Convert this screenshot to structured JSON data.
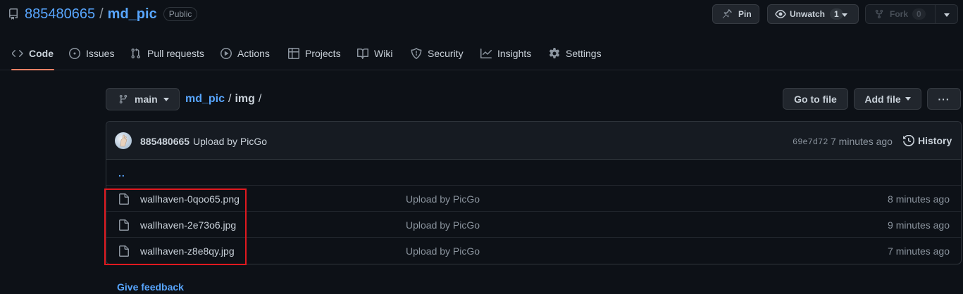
{
  "repo": {
    "owner": "885480665",
    "separator": "/",
    "name": "md_pic",
    "visibility": "Public"
  },
  "header_actions": {
    "pin_label": "Pin",
    "unwatch_label": "Unwatch",
    "watch_count": "1",
    "fork_label": "Fork",
    "fork_count": "0"
  },
  "tabs": [
    {
      "label": "Code",
      "icon": "code-icon",
      "active": true
    },
    {
      "label": "Issues",
      "icon": "issue-icon"
    },
    {
      "label": "Pull requests",
      "icon": "pull-request-icon"
    },
    {
      "label": "Actions",
      "icon": "play-icon"
    },
    {
      "label": "Projects",
      "icon": "table-icon"
    },
    {
      "label": "Wiki",
      "icon": "book-icon"
    },
    {
      "label": "Security",
      "icon": "shield-icon"
    },
    {
      "label": "Insights",
      "icon": "graph-icon"
    },
    {
      "label": "Settings",
      "icon": "gear-icon"
    }
  ],
  "branch": {
    "name": "main"
  },
  "breadcrumb": {
    "repo": "md_pic",
    "sep1": "/",
    "dir": "img",
    "sep2": "/"
  },
  "path_actions": {
    "goto_label": "Go to file",
    "addfile_label": "Add file",
    "more_label": "···"
  },
  "latest_commit": {
    "author": "885480665",
    "message": "Upload by PicGo",
    "sha": "69e7d72",
    "time": "7 minutes ago",
    "history_label": "History"
  },
  "parent_dir_label": "..",
  "files": [
    {
      "name": "wallhaven-0qoo65.png",
      "message": "Upload by PicGo",
      "age": "8 minutes ago"
    },
    {
      "name": "wallhaven-2e73o6.jpg",
      "message": "Upload by PicGo",
      "age": "9 minutes ago"
    },
    {
      "name": "wallhaven-z8e8qy.jpg",
      "message": "Upload by PicGo",
      "age": "7 minutes ago"
    }
  ],
  "footer": {
    "feedback_label": "Give feedback"
  },
  "colors": {
    "background": "#0d1117",
    "link": "#58a6ff",
    "active_tab_underline": "#f78166",
    "highlight_border": "#e0191f"
  }
}
